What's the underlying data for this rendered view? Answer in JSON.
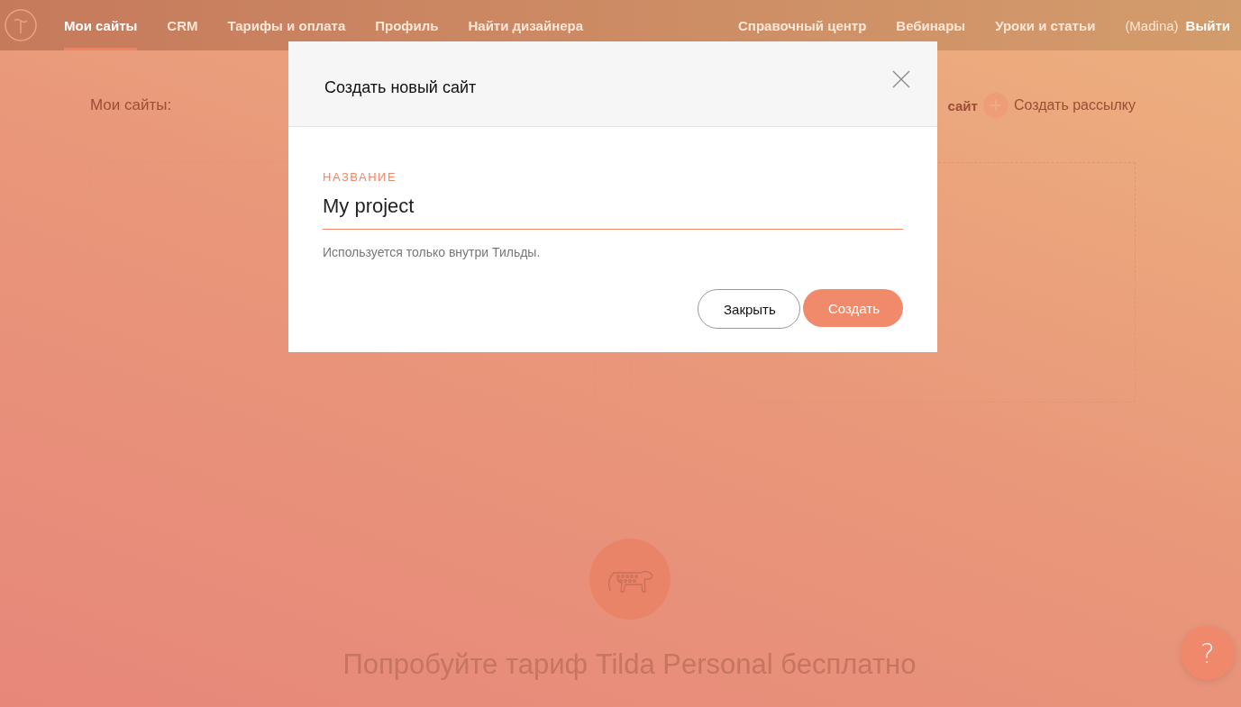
{
  "nav": {
    "items": [
      {
        "label": "Мои сайты",
        "selected": true
      },
      {
        "label": "CRM",
        "selected": false
      },
      {
        "label": "Тарифы и оплата",
        "selected": false
      },
      {
        "label": "Профиль",
        "selected": false
      },
      {
        "label": "Найти дизайнера",
        "selected": false
      }
    ],
    "right_items": [
      "Справочный центр",
      "Вебинары",
      "Уроки и статьи"
    ],
    "user": "(Madina)",
    "logout": "Выйти"
  },
  "page": {
    "heading": "Мои сайты:",
    "actions": [
      {
        "label": "сайт",
        "kind": "text"
      },
      {
        "label": "Создать рассылку",
        "kind": "plus"
      }
    ],
    "cards": [
      {
        "kind": "empty"
      },
      {
        "kind": "empty"
      }
    ],
    "promo": "Попробуйте тариф Tilda Personal бесплатно"
  },
  "help": "?",
  "modal": {
    "title": "Создать новый сайт",
    "field_label": "НАЗВАНИЕ",
    "value": "My project",
    "hint": "Используется только внутри Тильды.",
    "buttons": [
      {
        "label": "Закрыть",
        "kind": "secondary"
      },
      {
        "label": "Создать",
        "kind": "primary"
      }
    ]
  }
}
